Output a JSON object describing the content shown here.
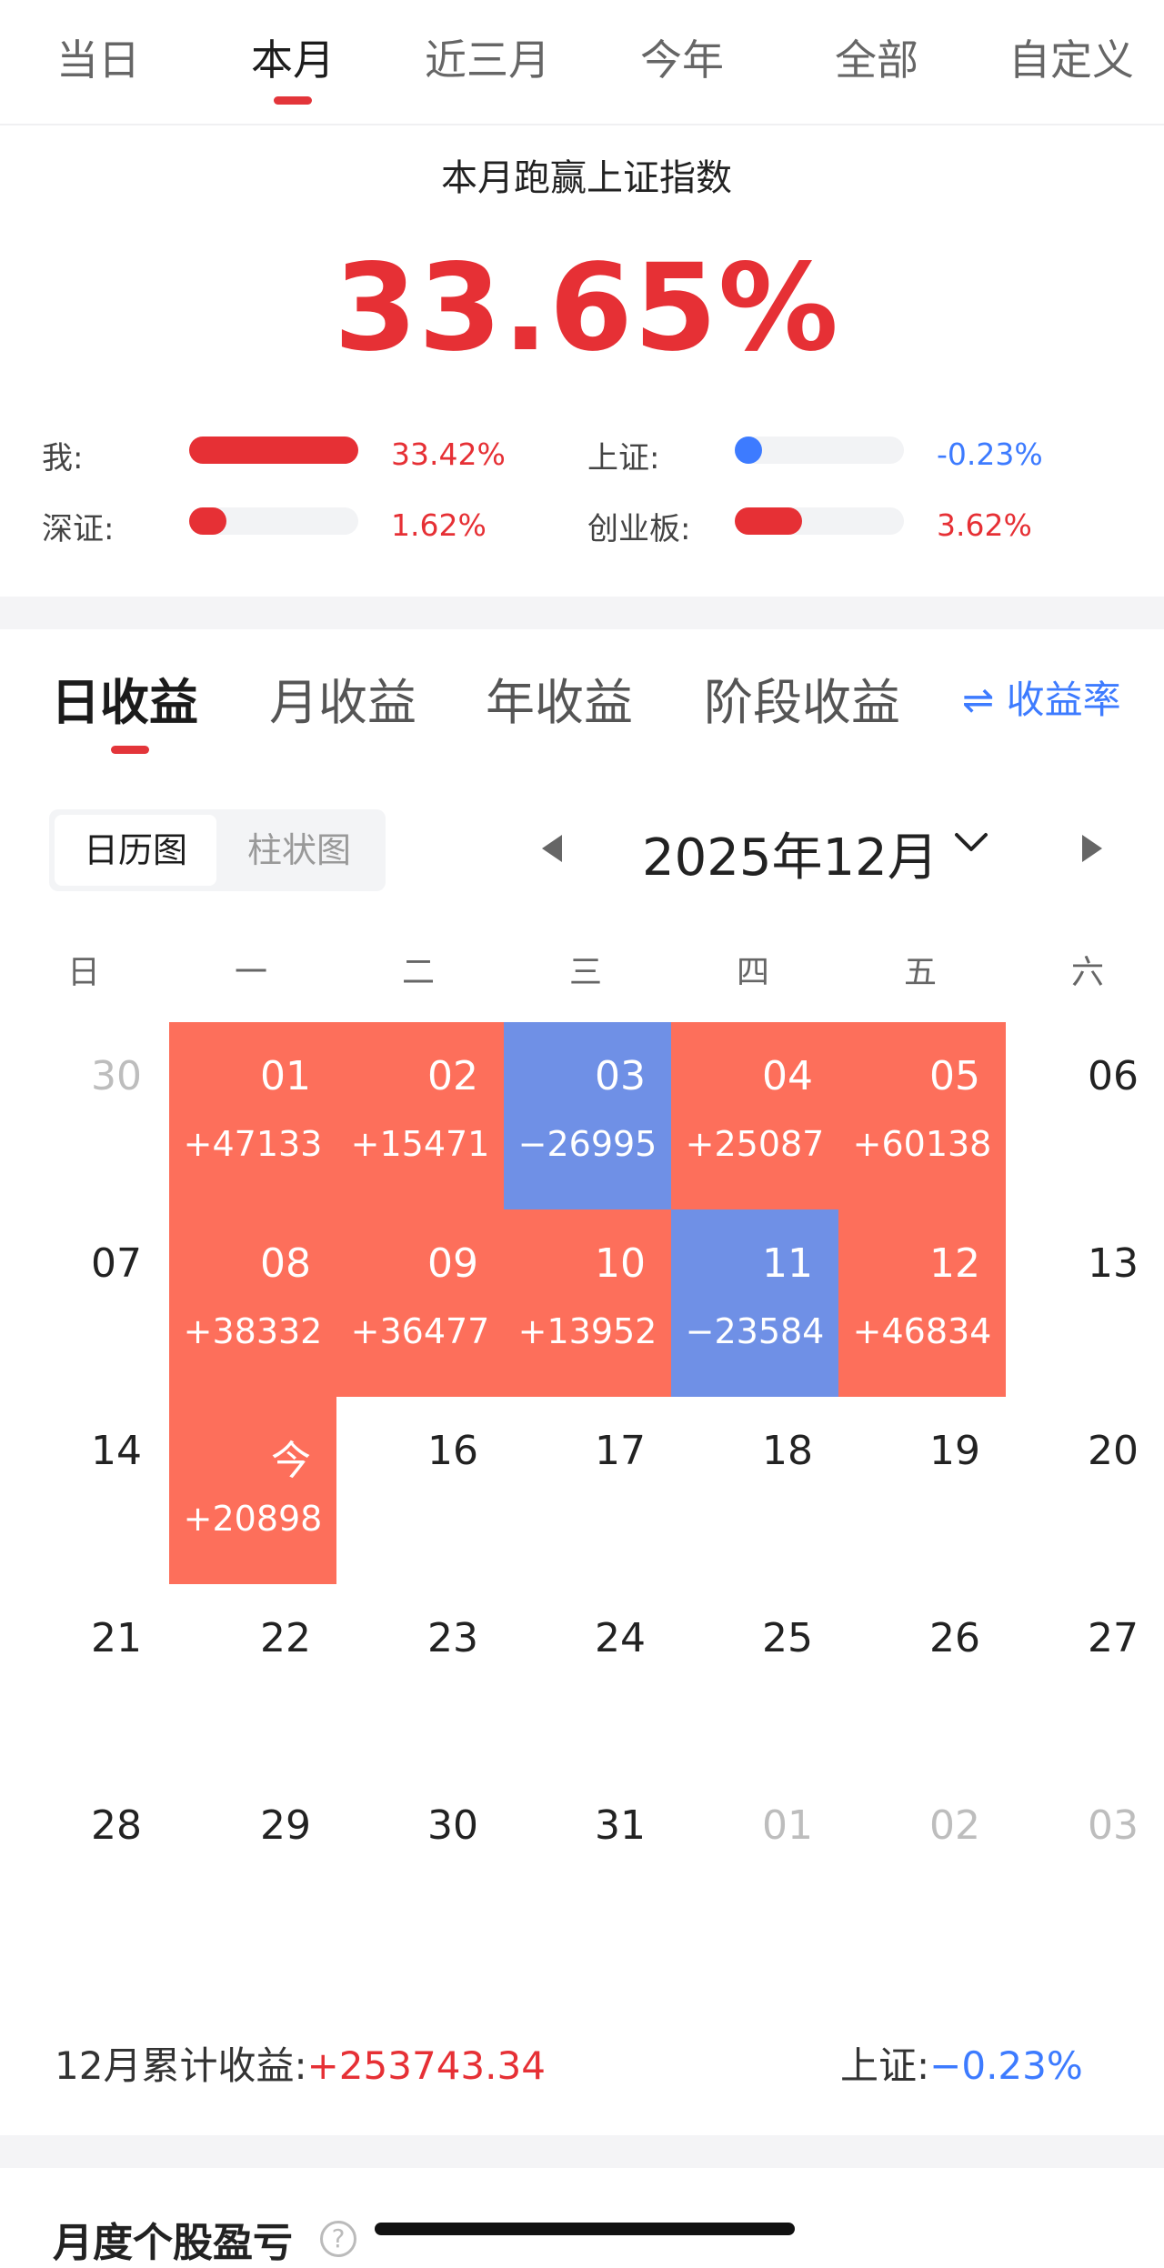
{
  "period_tabs": [
    {
      "label": "当日"
    },
    {
      "label": "本月",
      "active": true
    },
    {
      "label": "近三月"
    },
    {
      "label": "今年"
    },
    {
      "label": "全部"
    },
    {
      "label": "自定义"
    }
  ],
  "summary": {
    "title": "本月跑赢上证指数",
    "value": "33.65%",
    "comparisons": [
      {
        "label": "我:",
        "value": "33.42%",
        "fill": 1.0,
        "color": "#e63035"
      },
      {
        "label": "上证:",
        "value": "-0.23%",
        "fill": 0.1,
        "color": "#3d7bff"
      },
      {
        "label": "深证:",
        "value": "1.62%",
        "fill": 0.22,
        "color": "#e63035"
      },
      {
        "label": "创业板:",
        "value": "3.62%",
        "fill": 0.4,
        "color": "#e63035"
      }
    ]
  },
  "metric_tabs": [
    {
      "label": "日收益",
      "active": true
    },
    {
      "label": "月收益"
    },
    {
      "label": "年收益"
    },
    {
      "label": "阶段收益"
    }
  ],
  "rate_toggle": {
    "icon": "swap-arrows-icon",
    "label": "收益率"
  },
  "view_toggle": {
    "calendar_label": "日历图",
    "bar_label": "柱状图"
  },
  "month_label": "2025年12月",
  "weekdays": [
    "日",
    "一",
    "二",
    "三",
    "四",
    "五",
    "六"
  ],
  "calendar": [
    [
      {
        "day": "30",
        "dim": true
      },
      {
        "day": "01",
        "value": "+47133",
        "type": "gain"
      },
      {
        "day": "02",
        "value": "+15471",
        "type": "gain"
      },
      {
        "day": "03",
        "value": "−26995",
        "type": "loss"
      },
      {
        "day": "04",
        "value": "+25087",
        "type": "gain"
      },
      {
        "day": "05",
        "value": "+60138",
        "type": "gain"
      },
      {
        "day": "06"
      }
    ],
    [
      {
        "day": "07"
      },
      {
        "day": "08",
        "value": "+38332",
        "type": "gain"
      },
      {
        "day": "09",
        "value": "+36477",
        "type": "gain"
      },
      {
        "day": "10",
        "value": "+13952",
        "type": "gain"
      },
      {
        "day": "11",
        "value": "−23584",
        "type": "loss"
      },
      {
        "day": "12",
        "value": "+46834",
        "type": "gain"
      },
      {
        "day": "13"
      }
    ],
    [
      {
        "day": "14"
      },
      {
        "day": "今",
        "value": "+20898",
        "type": "gain"
      },
      {
        "day": "16"
      },
      {
        "day": "17"
      },
      {
        "day": "18"
      },
      {
        "day": "19"
      },
      {
        "day": "20"
      }
    ],
    [
      {
        "day": "21"
      },
      {
        "day": "22"
      },
      {
        "day": "23"
      },
      {
        "day": "24"
      },
      {
        "day": "25"
      },
      {
        "day": "26"
      },
      {
        "day": "27"
      }
    ],
    [
      {
        "day": "28"
      },
      {
        "day": "29"
      },
      {
        "day": "30"
      },
      {
        "day": "31"
      },
      {
        "day": "01",
        "dim": true
      },
      {
        "day": "02",
        "dim": true
      },
      {
        "day": "03",
        "dim": true
      }
    ]
  ],
  "footer": {
    "cumulative_label": "12月累计收益:",
    "cumulative_value": "+253743.34",
    "sh_label": "上证:",
    "sh_value": "−0.23%"
  },
  "next_section": {
    "title": "月度个股盈亏",
    "help_icon": "?"
  }
}
